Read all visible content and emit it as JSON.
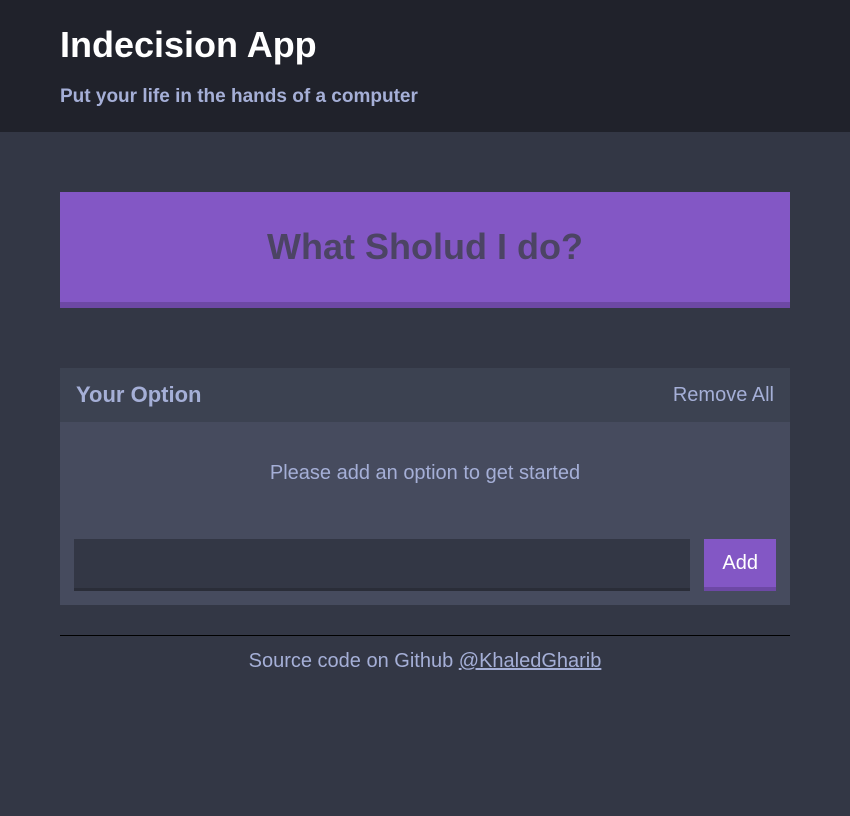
{
  "header": {
    "title": "Indecision App",
    "subtitle": "Put your life in the hands of a computer"
  },
  "action": {
    "big_button_label": "What Sholud I do?"
  },
  "widget": {
    "title": "Your Option",
    "remove_all_label": "Remove All",
    "empty_message": "Please add an option to get started"
  },
  "add_option": {
    "input_value": "",
    "button_label": "Add"
  },
  "footer": {
    "text": "Source code on Github ",
    "link_text": "@KhaledGharib"
  }
}
